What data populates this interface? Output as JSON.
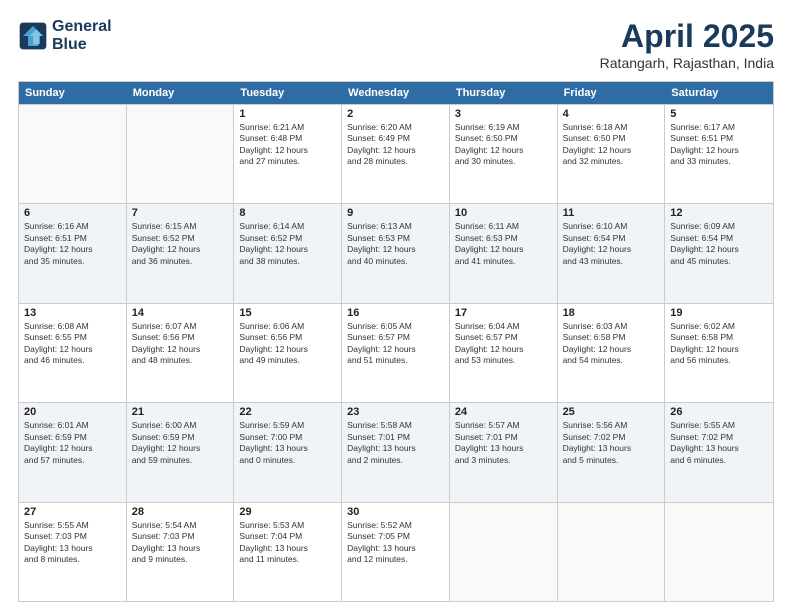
{
  "logo": {
    "line1": "General",
    "line2": "Blue"
  },
  "title": "April 2025",
  "location": "Ratangarh, Rajasthan, India",
  "days_of_week": [
    "Sunday",
    "Monday",
    "Tuesday",
    "Wednesday",
    "Thursday",
    "Friday",
    "Saturday"
  ],
  "weeks": [
    [
      {
        "day": "",
        "text": ""
      },
      {
        "day": "",
        "text": ""
      },
      {
        "day": "1",
        "text": "Sunrise: 6:21 AM\nSunset: 6:48 PM\nDaylight: 12 hours\nand 27 minutes."
      },
      {
        "day": "2",
        "text": "Sunrise: 6:20 AM\nSunset: 6:49 PM\nDaylight: 12 hours\nand 28 minutes."
      },
      {
        "day": "3",
        "text": "Sunrise: 6:19 AM\nSunset: 6:50 PM\nDaylight: 12 hours\nand 30 minutes."
      },
      {
        "day": "4",
        "text": "Sunrise: 6:18 AM\nSunset: 6:50 PM\nDaylight: 12 hours\nand 32 minutes."
      },
      {
        "day": "5",
        "text": "Sunrise: 6:17 AM\nSunset: 6:51 PM\nDaylight: 12 hours\nand 33 minutes."
      }
    ],
    [
      {
        "day": "6",
        "text": "Sunrise: 6:16 AM\nSunset: 6:51 PM\nDaylight: 12 hours\nand 35 minutes."
      },
      {
        "day": "7",
        "text": "Sunrise: 6:15 AM\nSunset: 6:52 PM\nDaylight: 12 hours\nand 36 minutes."
      },
      {
        "day": "8",
        "text": "Sunrise: 6:14 AM\nSunset: 6:52 PM\nDaylight: 12 hours\nand 38 minutes."
      },
      {
        "day": "9",
        "text": "Sunrise: 6:13 AM\nSunset: 6:53 PM\nDaylight: 12 hours\nand 40 minutes."
      },
      {
        "day": "10",
        "text": "Sunrise: 6:11 AM\nSunset: 6:53 PM\nDaylight: 12 hours\nand 41 minutes."
      },
      {
        "day": "11",
        "text": "Sunrise: 6:10 AM\nSunset: 6:54 PM\nDaylight: 12 hours\nand 43 minutes."
      },
      {
        "day": "12",
        "text": "Sunrise: 6:09 AM\nSunset: 6:54 PM\nDaylight: 12 hours\nand 45 minutes."
      }
    ],
    [
      {
        "day": "13",
        "text": "Sunrise: 6:08 AM\nSunset: 6:55 PM\nDaylight: 12 hours\nand 46 minutes."
      },
      {
        "day": "14",
        "text": "Sunrise: 6:07 AM\nSunset: 6:56 PM\nDaylight: 12 hours\nand 48 minutes."
      },
      {
        "day": "15",
        "text": "Sunrise: 6:06 AM\nSunset: 6:56 PM\nDaylight: 12 hours\nand 49 minutes."
      },
      {
        "day": "16",
        "text": "Sunrise: 6:05 AM\nSunset: 6:57 PM\nDaylight: 12 hours\nand 51 minutes."
      },
      {
        "day": "17",
        "text": "Sunrise: 6:04 AM\nSunset: 6:57 PM\nDaylight: 12 hours\nand 53 minutes."
      },
      {
        "day": "18",
        "text": "Sunrise: 6:03 AM\nSunset: 6:58 PM\nDaylight: 12 hours\nand 54 minutes."
      },
      {
        "day": "19",
        "text": "Sunrise: 6:02 AM\nSunset: 6:58 PM\nDaylight: 12 hours\nand 56 minutes."
      }
    ],
    [
      {
        "day": "20",
        "text": "Sunrise: 6:01 AM\nSunset: 6:59 PM\nDaylight: 12 hours\nand 57 minutes."
      },
      {
        "day": "21",
        "text": "Sunrise: 6:00 AM\nSunset: 6:59 PM\nDaylight: 12 hours\nand 59 minutes."
      },
      {
        "day": "22",
        "text": "Sunrise: 5:59 AM\nSunset: 7:00 PM\nDaylight: 13 hours\nand 0 minutes."
      },
      {
        "day": "23",
        "text": "Sunrise: 5:58 AM\nSunset: 7:01 PM\nDaylight: 13 hours\nand 2 minutes."
      },
      {
        "day": "24",
        "text": "Sunrise: 5:57 AM\nSunset: 7:01 PM\nDaylight: 13 hours\nand 3 minutes."
      },
      {
        "day": "25",
        "text": "Sunrise: 5:56 AM\nSunset: 7:02 PM\nDaylight: 13 hours\nand 5 minutes."
      },
      {
        "day": "26",
        "text": "Sunrise: 5:55 AM\nSunset: 7:02 PM\nDaylight: 13 hours\nand 6 minutes."
      }
    ],
    [
      {
        "day": "27",
        "text": "Sunrise: 5:55 AM\nSunset: 7:03 PM\nDaylight: 13 hours\nand 8 minutes."
      },
      {
        "day": "28",
        "text": "Sunrise: 5:54 AM\nSunset: 7:03 PM\nDaylight: 13 hours\nand 9 minutes."
      },
      {
        "day": "29",
        "text": "Sunrise: 5:53 AM\nSunset: 7:04 PM\nDaylight: 13 hours\nand 11 minutes."
      },
      {
        "day": "30",
        "text": "Sunrise: 5:52 AM\nSunset: 7:05 PM\nDaylight: 13 hours\nand 12 minutes."
      },
      {
        "day": "",
        "text": ""
      },
      {
        "day": "",
        "text": ""
      },
      {
        "day": "",
        "text": ""
      }
    ]
  ]
}
